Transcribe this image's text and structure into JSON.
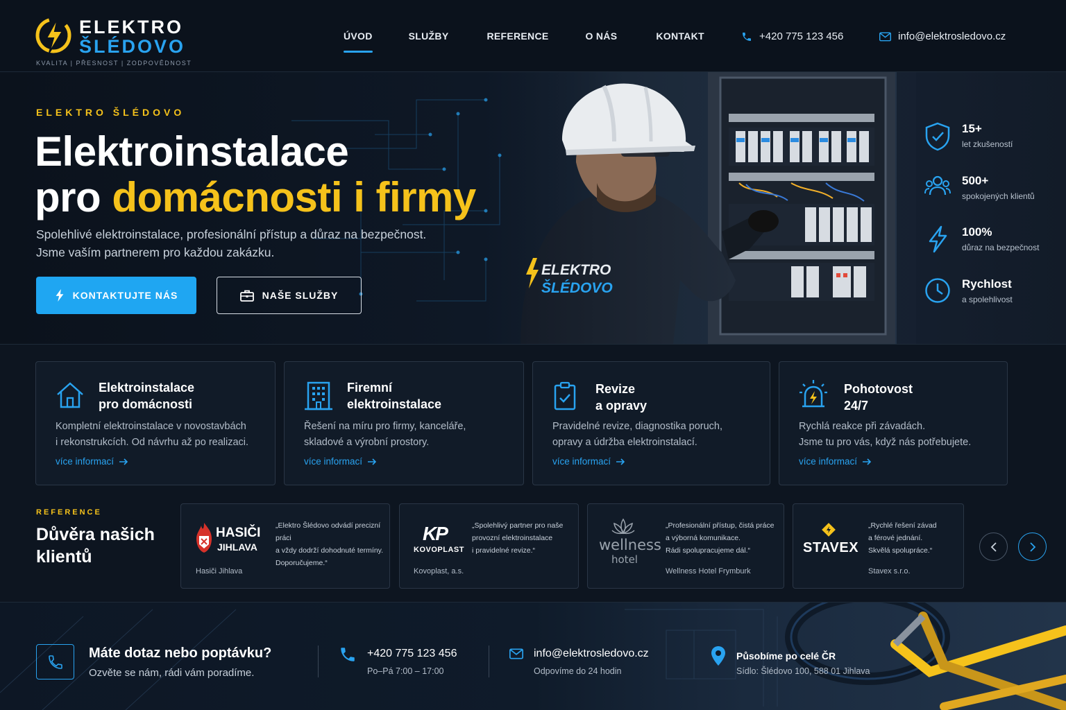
{
  "brand": {
    "line1": "ELEKTRO",
    "line2": "ŠLÉDOVO",
    "tagline": "KVALITA  |  PŘESNOST  |  ZODPOVĚDNOST",
    "accent_blue": "#29a3f0",
    "accent_yellow": "#f5c21b"
  },
  "nav": {
    "items": [
      {
        "label": "ÚVOD",
        "active": true
      },
      {
        "label": "SLUŽBY"
      },
      {
        "label": "REFERENCE"
      },
      {
        "label": "O NÁS"
      },
      {
        "label": "KONTAKT"
      }
    ],
    "phone": "+420 775 123 456",
    "email": "info@elektrosledovo.cz"
  },
  "hero": {
    "eyebrow": "ELEKTRO ŠLÉDOVO",
    "title_line1": "Elektroinstalace",
    "title_line2_prefix": "pro ",
    "title_line2_highlight": "domácnosti i firmy",
    "subtitle_line1": "Spolehlivé elektroinstalace, profesionální přístup a důraz na bezpečnost.",
    "subtitle_line2": "Jsme vaším partnerem pro každou zakázku.",
    "cta_primary": "KONTAKTUJTE NÁS",
    "cta_secondary": "NAŠE SLUŽBY",
    "jacket_logo_line1": "ELEKTRO",
    "jacket_logo_line2": "ŠLÉDOVO"
  },
  "stats": [
    {
      "value": "15+",
      "label": "let zkušeností",
      "icon": "shield-check-icon"
    },
    {
      "value": "500+",
      "label": "spokojených klientů",
      "icon": "users-icon"
    },
    {
      "value": "100%",
      "label": "důraz na bezpečnost",
      "icon": "lightning-icon"
    },
    {
      "value": "Rychlost",
      "label": "a spolehlivost",
      "icon": "clock-icon"
    }
  ],
  "services": [
    {
      "title_line1": "Elektroinstalace",
      "title_line2": "pro domácnosti",
      "desc_line1": "Kompletní elektroinstalace v novostavbách",
      "desc_line2": "i rekonstrukcích. Od návrhu až po realizaci.",
      "more": "více informací",
      "icon": "house-icon"
    },
    {
      "title_line1": "Firemní",
      "title_line2": "elektroinstalace",
      "desc_line1": "Řešení na míru pro firmy, kanceláře,",
      "desc_line2": "skladové a výrobní prostory.",
      "more": "více informací",
      "icon": "building-icon"
    },
    {
      "title_line1": "Revize",
      "title_line2": "a opravy",
      "desc_line1": "Pravidelné revize, diagnostika poruch,",
      "desc_line2": "opravy a údržba elektroinstalací.",
      "more": "více informací",
      "icon": "clipboard-check-icon"
    },
    {
      "title_line1": "Pohotovost",
      "title_line2": "24/7",
      "desc_line1": "Rychlá reakce při závadách.",
      "desc_line2": "Jsme tu pro vás, když nás potřebujete.",
      "more": "více informací",
      "icon": "alarm-light-icon"
    }
  ],
  "references": {
    "eyebrow": "REFERENCE",
    "title_line1": "Důvěra našich",
    "title_line2": "klientů",
    "items": [
      {
        "logo_line1": "HASIČI",
        "logo_line2": "JIHLAVA",
        "quote_line1": "„Elektro Šlédovo odvádí precizní práci",
        "quote_line2": "a vždy dodrží dohodnuté termíny.",
        "quote_line3": "Doporučujeme.“",
        "name": "Hasiči Jihlava"
      },
      {
        "logo_line1": "KP",
        "logo_line2": "KOVOPLAST",
        "quote_line1": "„Spolehlivý partner pro naše",
        "quote_line2": "provozní elektroinstalace",
        "quote_line3": "i pravidelné revize.“",
        "name": "Kovoplast, a.s."
      },
      {
        "logo_line1": "wellness",
        "logo_line2": "hotel",
        "quote_line1": "„Profesionální přístup, čistá práce",
        "quote_line2": "a výborná komunikace.",
        "quote_line3": "Rádi spolupracujeme dál.“",
        "name": "Wellness Hotel Frymburk"
      },
      {
        "logo_line1": "STAVEX",
        "logo_line2": "",
        "quote_line1": "„Rychlé řešení závad",
        "quote_line2": "a férové jednání.",
        "quote_line3": "Skvělá spolupráce.“",
        "name": "Stavex s.r.o."
      }
    ]
  },
  "footer": {
    "title": "Máte dotaz nebo poptávku?",
    "subtitle": "Ozvěte se nám, rádi vám poradíme.",
    "phone": "+420 775 123 456",
    "hours": "Po–Pá 7:00 – 17:00",
    "email": "info@elektrosledovo.cz",
    "email_note": "Odpovíme do 24 hodin",
    "area": "Působíme po celé ČR",
    "address": "Sídlo: Šlédovo 100, 588 01 Jihlava"
  }
}
